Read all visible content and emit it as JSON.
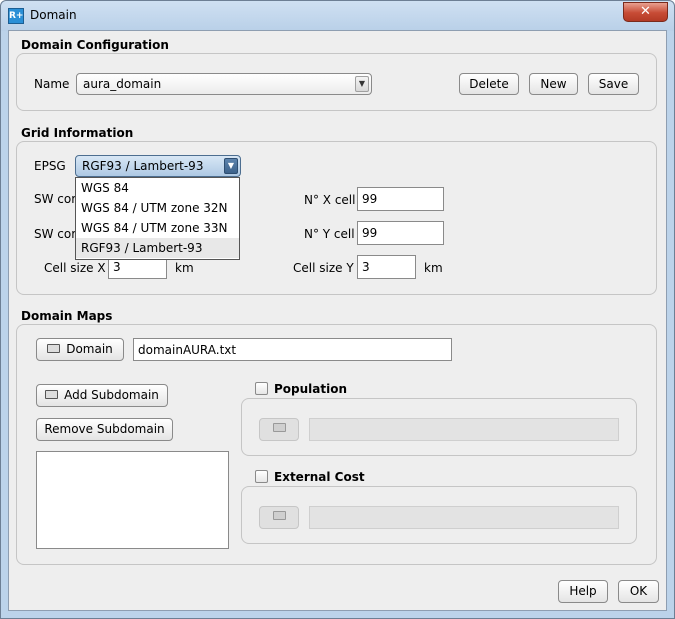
{
  "window": {
    "title": "Domain",
    "app_icon_text": "R+",
    "close_glyph": "✕"
  },
  "domain_config": {
    "section_title": "Domain Configuration",
    "name_label": "Name",
    "name_value": "aura_domain",
    "delete_label": "Delete",
    "new_label": "New",
    "save_label": "Save"
  },
  "grid_info": {
    "section_title": "Grid Information",
    "epsg_label": "EPSG",
    "epsg_value": "RGF93 / Lambert-93",
    "epsg_options": [
      "WGS 84",
      "WGS 84 / UTM zone 32N",
      "WGS 84 / UTM zone 33N",
      "RGF93 / Lambert-93"
    ],
    "sw_corner_x_label": "SW cor",
    "sw_corner_y_label": "SW cor",
    "nx_label": "N° X cell",
    "nx_value": "99",
    "ny_label": "N° Y cell",
    "ny_value": "99",
    "cell_size_x_label": "Cell size X",
    "cell_size_x_value": "3",
    "cell_size_x_unit": "km",
    "cell_size_y_label": "Cell size Y",
    "cell_size_y_value": "3",
    "cell_size_y_unit": "km"
  },
  "domain_maps": {
    "section_title": "Domain Maps",
    "domain_button": "Domain",
    "domain_file": "domainAURA.txt",
    "add_subdomain": "Add Subdomain",
    "remove_subdomain": "Remove Subdomain",
    "population_label": "Population",
    "external_cost_label": "External Cost"
  },
  "footer": {
    "help_label": "Help",
    "ok_label": "OK"
  },
  "icons": {
    "folder": "folder-icon",
    "dropdown_arrow": "▼"
  }
}
